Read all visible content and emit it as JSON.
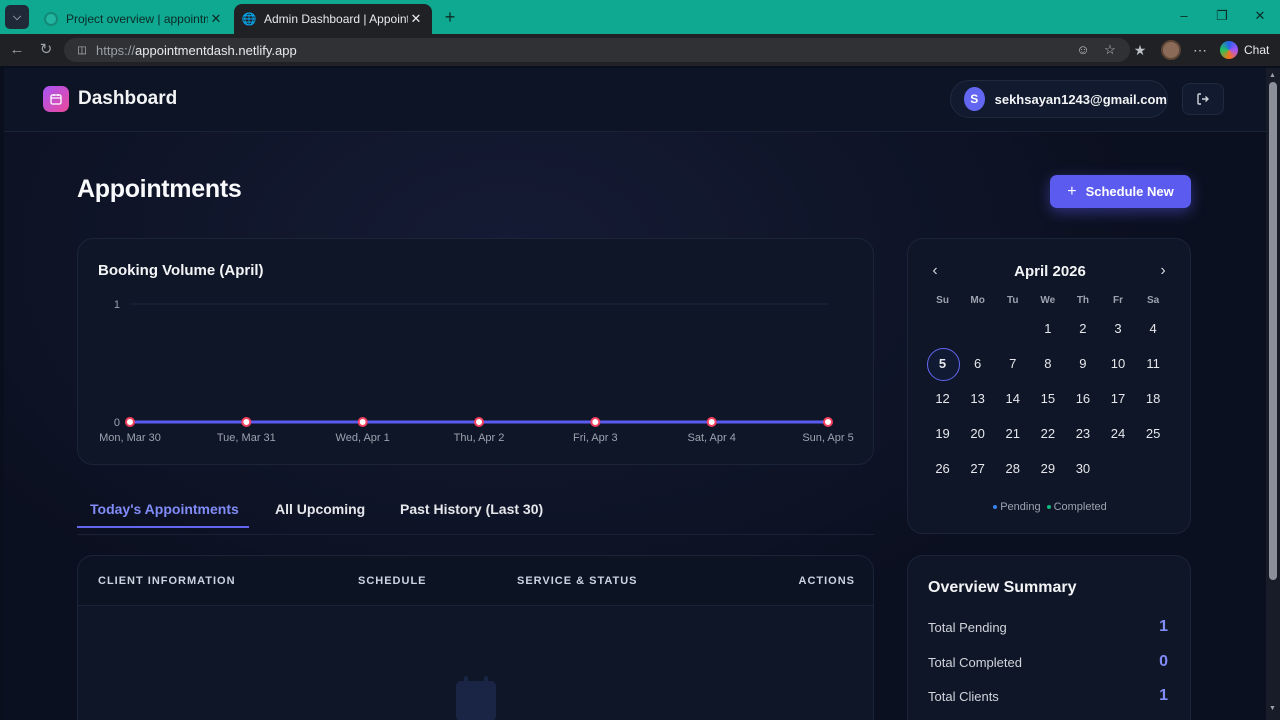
{
  "browser": {
    "tabs": [
      {
        "title": "Project overview | appointmentdas"
      },
      {
        "title": "Admin Dashboard | Appointments"
      }
    ],
    "url_scheme": "https://",
    "url_host": "appointmentdash.netlify.app",
    "chat_label": "Chat"
  },
  "header": {
    "brand": "Dashboard",
    "user_initial": "S",
    "user_email": "sekhsayan1243@gmail.com"
  },
  "page": {
    "title": "Appointments",
    "schedule_button": "Schedule New"
  },
  "chart_data": {
    "type": "line",
    "title": "Booking Volume (April)",
    "categories": [
      "Mon, Mar 30",
      "Tue, Mar 31",
      "Wed, Apr 1",
      "Thu, Apr 2",
      "Fri, Apr 3",
      "Sat, Apr 4",
      "Sun, Apr 5"
    ],
    "values": [
      0,
      0,
      0,
      0,
      0,
      0,
      0
    ],
    "yticks": [
      "0",
      "1"
    ],
    "ylim": [
      0,
      1
    ],
    "grid": true,
    "line_color": "#5b5bf0",
    "point_color": "#f43f5e"
  },
  "calendar": {
    "month_label": "April 2026",
    "weekdays": [
      "Su",
      "Mo",
      "Tu",
      "We",
      "Th",
      "Fr",
      "Sa"
    ],
    "weeks": [
      [
        "",
        "",
        "",
        "1",
        "2",
        "3",
        "4"
      ],
      [
        "5",
        "6",
        "7",
        "8",
        "9",
        "10",
        "11"
      ],
      [
        "12",
        "13",
        "14",
        "15",
        "16",
        "17",
        "18"
      ],
      [
        "19",
        "20",
        "21",
        "22",
        "23",
        "24",
        "25"
      ],
      [
        "26",
        "27",
        "28",
        "29",
        "30",
        "",
        ""
      ]
    ],
    "today": "5",
    "legend": [
      {
        "label": "Pending",
        "color": "#3b82f6"
      },
      {
        "label": "Completed",
        "color": "#10b981"
      }
    ]
  },
  "tabs": [
    {
      "label": "Today's Appointments",
      "active": true
    },
    {
      "label": "All Upcoming",
      "active": false
    },
    {
      "label": "Past History (Last 30)",
      "active": false
    }
  ],
  "table": {
    "headers": [
      "CLIENT INFORMATION",
      "SCHEDULE",
      "SERVICE & STATUS",
      "ACTIONS"
    ]
  },
  "summary": {
    "title": "Overview Summary",
    "rows": [
      {
        "label": "Total Pending",
        "value": "1"
      },
      {
        "label": "Total Completed",
        "value": "0"
      },
      {
        "label": "Total Clients",
        "value": "1"
      }
    ]
  },
  "icons": {
    "logo": "calendar-icon",
    "logout": "logout-icon",
    "empty_state": "calendar-icon"
  }
}
